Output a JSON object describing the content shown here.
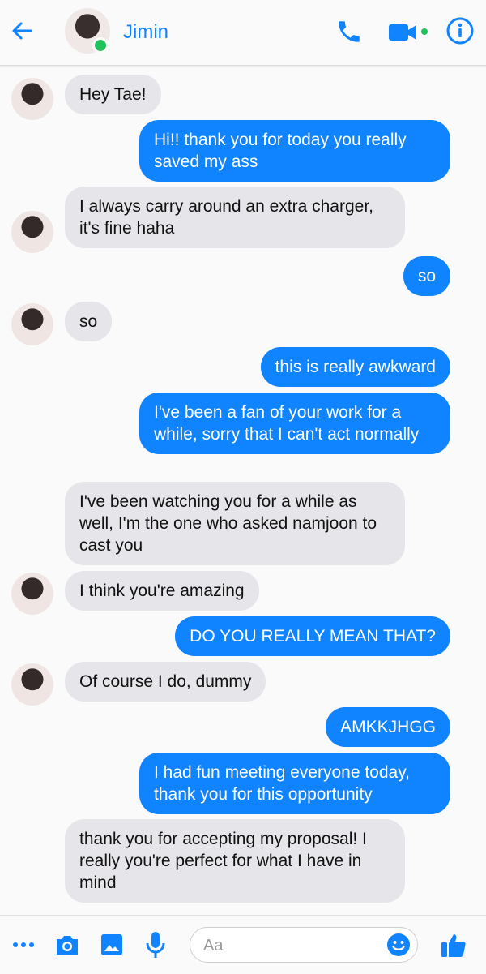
{
  "header": {
    "contact_name": "Jimin",
    "back_icon": "arrow-left-icon",
    "call_icon": "phone-icon",
    "video_icon": "video-camera-icon",
    "info_icon": "info-icon",
    "accent_color": "#1083ff",
    "online_color": "#22c25b"
  },
  "messages": [
    {
      "sender": "them",
      "text": "Hey Tae!"
    },
    {
      "sender": "me",
      "text": "Hi!! thank you for today you really saved my ass"
    },
    {
      "sender": "them",
      "text": "I always carry around an extra charger, it's fine haha"
    },
    {
      "sender": "me",
      "text": "so"
    },
    {
      "sender": "them",
      "text": "so"
    },
    {
      "sender": "me",
      "text": "this is really awkward"
    },
    {
      "sender": "me",
      "text": "I've been a fan of your work for a while, sorry that I can't act normally"
    },
    {
      "sender": "them",
      "text": "I've been watching you for a while as well, I'm the one who asked namjoon to cast you"
    },
    {
      "sender": "them",
      "text": "I think you're amazing"
    },
    {
      "sender": "me",
      "text": "DO YOU REALLY MEAN THAT?"
    },
    {
      "sender": "them",
      "text": "Of course I do, dummy"
    },
    {
      "sender": "me",
      "text": "AMKKJHGG"
    },
    {
      "sender": "me",
      "text": "I had fun meeting everyone today, thank you for this opportunity"
    },
    {
      "sender": "them",
      "text": "thank you for accepting my proposal! I really you're perfect for what I have in mind"
    }
  ],
  "composer": {
    "placeholder": "Aa",
    "icons": [
      "more-icon",
      "camera-icon",
      "gallery-icon",
      "microphone-icon",
      "emoji-icon",
      "thumbs-up-icon"
    ]
  }
}
